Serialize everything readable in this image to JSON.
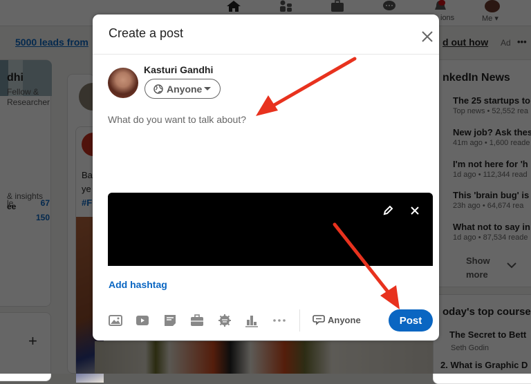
{
  "nav": {
    "items": [
      {
        "icon": "home-icon",
        "label": ""
      },
      {
        "icon": "network-icon",
        "label": ""
      },
      {
        "icon": "jobs-icon",
        "label": ""
      },
      {
        "icon": "messaging-icon",
        "label": ""
      },
      {
        "icon": "notifications-icon",
        "label": "ions"
      },
      {
        "icon": "me-avatar",
        "label": "Me"
      }
    ]
  },
  "ad": {
    "left_link": "5000 leads from",
    "right_link": "d out how",
    "ad_label": "Ad",
    "more": "•••"
  },
  "profile": {
    "name": "dhi",
    "subtitle": "Fellow & Researcher",
    "stats": [
      {
        "label": "le",
        "value": "67"
      },
      {
        "label": "",
        "value": "150"
      }
    ],
    "insights_line1": "& insights",
    "insights_line2": "ee"
  },
  "feed": {
    "text_line1": "Ba",
    "text_line2": "ye",
    "tag": "#F"
  },
  "news": {
    "title": "nkedIn News",
    "items": [
      {
        "headline": "The 25 startups to",
        "meta": "Top news • 52,552 rea"
      },
      {
        "headline": "New job? Ask these",
        "meta": "41m ago • 1,600 reade"
      },
      {
        "headline": "I'm not here for 'h",
        "meta": "1d ago • 112,344 read"
      },
      {
        "headline": "This 'brain bug' is",
        "meta": "23h ago • 64,674 rea"
      },
      {
        "headline": "What not to say in",
        "meta": "1d ago • 87,534 reade"
      }
    ],
    "show_more": "Show more"
  },
  "courses": {
    "title": "oday's top course",
    "items": [
      {
        "title": "The Secret to Bett",
        "author": "Seth Godin"
      },
      {
        "title": "2. What is Graphic D",
        "author": ""
      }
    ]
  },
  "modal": {
    "title": "Create a post",
    "author_name": "Kasturi Gandhi",
    "audience": "Anyone",
    "placeholder": "What do you want to talk about?",
    "add_hashtag": "Add hashtag",
    "toolbar": [
      "photo-icon",
      "video-icon",
      "document-icon",
      "job-icon",
      "celebrate-icon",
      "poll-icon",
      "more-icon"
    ],
    "comment_control": "Anyone",
    "post_button": "Post"
  },
  "colors": {
    "accent": "#0a66c2",
    "annotation_arrow": "#e8321e"
  }
}
